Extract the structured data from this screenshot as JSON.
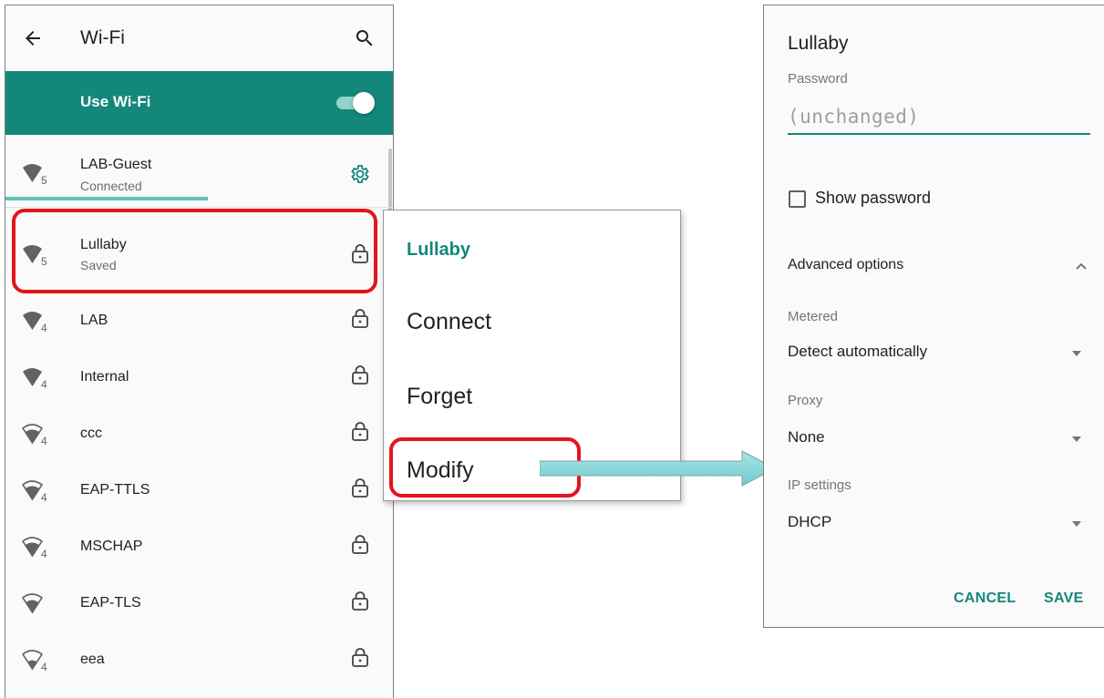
{
  "left": {
    "title": "Wi-Fi",
    "use_wifi_label": "Use Wi-Fi",
    "use_wifi_on": true,
    "networks": [
      {
        "name": "LAB-Guest",
        "status": "Connected",
        "band": "5",
        "secured": false,
        "settings": true
      },
      {
        "name": "Lullaby",
        "status": "Saved",
        "band": "5",
        "secured": true
      },
      {
        "name": "LAB",
        "status": "",
        "band": "4",
        "secured": true
      },
      {
        "name": "Internal",
        "status": "",
        "band": "4",
        "secured": true
      },
      {
        "name": "ccc",
        "status": "",
        "band": "4",
        "secured": true
      },
      {
        "name": "EAP-TTLS",
        "status": "",
        "band": "4",
        "secured": true
      },
      {
        "name": "MSCHAP",
        "status": "",
        "band": "4",
        "secured": true
      },
      {
        "name": "EAP-TLS",
        "status": "",
        "band": "",
        "secured": true
      },
      {
        "name": "eea",
        "status": "",
        "band": "4",
        "secured": true
      }
    ]
  },
  "menu": {
    "title": "Lullaby",
    "items": [
      "Connect",
      "Forget",
      "Modify"
    ]
  },
  "dialog": {
    "title": "Lullaby",
    "password_label": "Password",
    "password_placeholder": "(unchanged)",
    "show_password_label": "Show password",
    "show_password_checked": false,
    "advanced_label": "Advanced options",
    "metered_label": "Metered",
    "metered_value": "Detect automatically",
    "proxy_label": "Proxy",
    "proxy_value": "None",
    "ip_label": "IP settings",
    "ip_value": "DHCP",
    "cancel_label": "CANCEL",
    "save_label": "SAVE"
  },
  "colors": {
    "accent": "#13877a",
    "highlight": "#e2151b",
    "arrow": "#7ed3d6"
  }
}
